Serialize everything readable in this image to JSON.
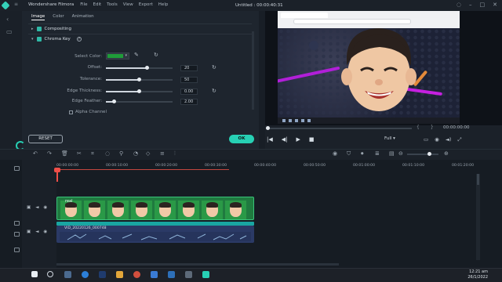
{
  "app": {
    "name": "Wondershare Filmora",
    "window_title": "Untitled : 00:00:40:31",
    "menu": [
      "File",
      "Edit",
      "Tools",
      "View",
      "Export",
      "Help"
    ]
  },
  "panel": {
    "tabs": [
      "Image",
      "Color",
      "Animation"
    ],
    "active_tab": "Image",
    "sections": {
      "compositing": "Compositing",
      "chroma_key": "Chroma Key"
    },
    "select_color_label": "Select Color:",
    "selected_color": "#1f9c39",
    "sliders": [
      {
        "label": "Offset:",
        "value": "20",
        "level": 0.62
      },
      {
        "label": "Tolerance:",
        "value": "50",
        "level": 0.5
      },
      {
        "label": "Edge Thickness:",
        "value": "0.00",
        "level": 0.5
      },
      {
        "label": "Edge Feather:",
        "value": "2.00",
        "level": 0.12
      }
    ],
    "alpha_channel": "Alpha Channel",
    "reset_button": "RESET",
    "ok_button": "OK"
  },
  "preview": {
    "timecode": "00:00:00:00",
    "quality": "Full",
    "position": 0.0
  },
  "timeline": {
    "ruler": [
      "00:00:00:00",
      "00:00:10:00",
      "00:00:20:00",
      "00:00:30:00",
      "00:00:40:00",
      "00:00:50:00",
      "00:01:00:00",
      "00:01:10:00",
      "00:01:20:00"
    ],
    "clips": [
      {
        "name": "real"
      },
      {
        "name": "VID_20220126_000748"
      }
    ]
  },
  "taskbar": {
    "time": "12:21 am",
    "date": "26/1/2022"
  },
  "colors": {
    "accent": "#27d0b4",
    "playhead": "#ef4e48"
  }
}
